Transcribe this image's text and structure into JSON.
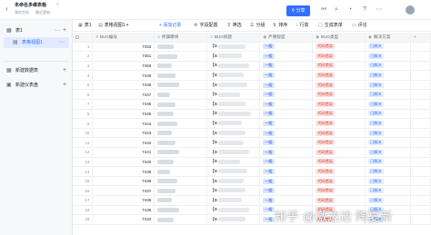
{
  "header": {
    "doc_title": "未命名多维表格",
    "meta_left": "我的空间",
    "meta_right": "最近更新",
    "share_label": "分享",
    "back_icon": "back-arrow-icon",
    "star_icon": "star-icon",
    "toolbar_icons": [
      "link-icon",
      "search-icon",
      "bell-icon",
      "help-icon",
      "more-icon"
    ]
  },
  "sidebar": {
    "items": [
      {
        "label": "表1",
        "icon": "table-icon"
      },
      {
        "label": "表格视图1",
        "icon": "grid-view-icon"
      },
      {
        "label": "新建数据表",
        "icon": "table-icon"
      },
      {
        "label": "新建仪表盘",
        "icon": "dashboard-icon"
      }
    ]
  },
  "tabbar": {
    "table_tab": "表1",
    "view_tab": "表格视图1",
    "add_record": "+ 添加记录",
    "field_config": "字段配置",
    "filter": "筛选",
    "group": "分组",
    "sort": "排序",
    "row_height": "行高",
    "generate_form": "生成表单",
    "comments": "评论"
  },
  "table": {
    "columns": [
      "BUG编号",
      "所属模块",
      "BUG标题",
      "严重程度",
      "BUG类型",
      "解决方案"
    ],
    "rows": [
      {
        "num": "1",
        "bug_id": "7453",
        "title_prefix": "【B",
        "severity": "一般",
        "type": "代码错误",
        "solution": "已解决"
      },
      {
        "num": "2",
        "bug_id": "7451",
        "title_prefix": "【B",
        "severity": "一般",
        "type": "代码错误",
        "solution": "已解决"
      },
      {
        "num": "3",
        "bug_id": "7450",
        "title_prefix": "【B",
        "severity": "一般",
        "type": "代码错误",
        "solution": "已解决"
      },
      {
        "num": "4",
        "bug_id": "7449",
        "title_prefix": "【B",
        "severity": "一般",
        "type": "代码错误",
        "solution": "已解决"
      },
      {
        "num": "5",
        "bug_id": "7448",
        "title_prefix": "【B",
        "severity": "一般",
        "type": "代码错误",
        "solution": "已解决"
      },
      {
        "num": "6",
        "bug_id": "7447",
        "title_prefix": "【B",
        "severity": "一般",
        "type": "代码错误",
        "solution": "已解决"
      },
      {
        "num": "7",
        "bug_id": "7446",
        "title_prefix": "【B",
        "severity": "一般",
        "type": "代码错误",
        "solution": "已解决"
      },
      {
        "num": "8",
        "bug_id": "7445",
        "title_prefix": "【B",
        "severity": "一般",
        "type": "代码错误",
        "solution": "已解决"
      },
      {
        "num": "9",
        "bug_id": "7444",
        "title_prefix": "【B",
        "severity": "一般",
        "type": "代码错误",
        "solution": "已解决"
      },
      {
        "num": "10",
        "bug_id": "7443",
        "title_prefix": "【B",
        "severity": "一般",
        "type": "代码错误",
        "solution": "已解决"
      },
      {
        "num": "11",
        "bug_id": "7442",
        "title_prefix": "【B",
        "severity": "一般",
        "type": "代码错误",
        "solution": "已解决"
      },
      {
        "num": "12",
        "bug_id": "7441",
        "title_prefix": "【B",
        "severity": "一般",
        "type": "代码错误",
        "solution": "已解决"
      },
      {
        "num": "13",
        "bug_id": "7440",
        "title_prefix": "【B",
        "severity": "一般",
        "type": "代码错误",
        "solution": "已解决"
      },
      {
        "num": "14",
        "bug_id": "7439",
        "title_prefix": "【B",
        "severity": "一般",
        "type": "代码错误",
        "solution": "已解决"
      },
      {
        "num": "15",
        "bug_id": "7438",
        "title_prefix": "【B",
        "severity": "一般",
        "type": "代码错误",
        "solution": "已解决"
      },
      {
        "num": "16",
        "bug_id": "7437",
        "title_prefix": "【B",
        "severity": "一般",
        "type": "代码错误",
        "solution": "已解决"
      },
      {
        "num": "17",
        "bug_id": "7436",
        "title_prefix": "【B",
        "severity": "一般",
        "type": "代码错误",
        "solution": "已解决"
      },
      {
        "num": "18",
        "bug_id": "7435",
        "title_prefix": "【B",
        "severity": "一般",
        "type": "代码错误",
        "solution": "已解决"
      },
      {
        "num": "19",
        "bug_id": "7434",
        "title_prefix": "【B",
        "severity": "一般",
        "type": "代码错误",
        "solution": "已解决"
      }
    ]
  },
  "watermark": "知乎 @激达达 陶夏新",
  "colors": {
    "accent": "#3370ff",
    "severity_bg": "#dbe6fc",
    "type_bg": "#fde3e3",
    "solution_bg": "#e5f0ff"
  }
}
